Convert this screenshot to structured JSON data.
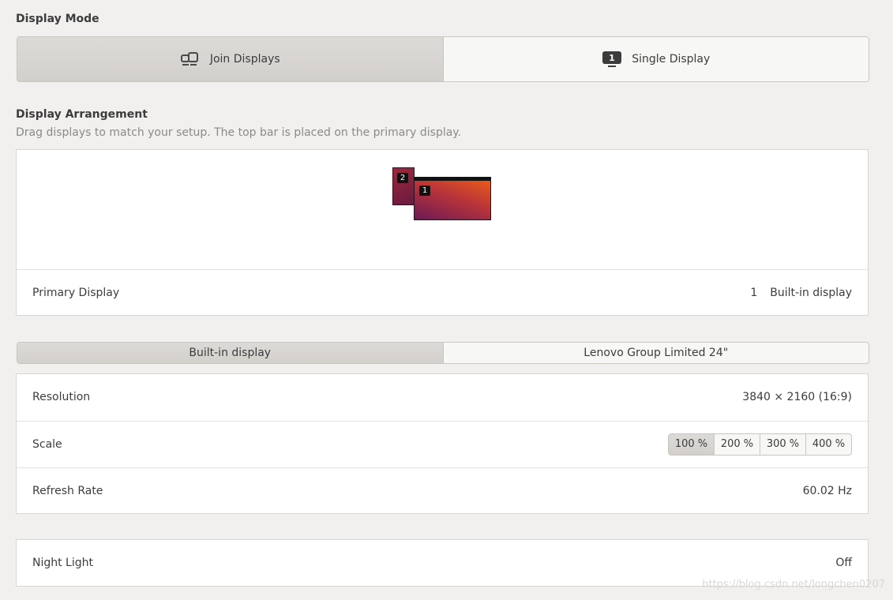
{
  "display_mode": {
    "title": "Display Mode",
    "join_label": "Join Displays",
    "single_label": "Single Display",
    "active": "join"
  },
  "arrangement": {
    "title": "Display Arrangement",
    "subtitle": "Drag displays to match your setup. The top bar is placed on the primary display.",
    "monitors": [
      {
        "id": "2",
        "label": "2"
      },
      {
        "id": "1",
        "label": "1"
      }
    ],
    "primary_label": "Primary Display",
    "primary_number": "1",
    "primary_name": "Built-in display"
  },
  "tabs": {
    "items": [
      "Built-in display",
      "Lenovo Group Limited 24\""
    ],
    "active_index": 0
  },
  "settings": {
    "resolution_label": "Resolution",
    "resolution_value": "3840 × 2160 (16:9)",
    "scale_label": "Scale",
    "scale_options": [
      "100 %",
      "200 %",
      "300 %",
      "400 %"
    ],
    "scale_active_index": 0,
    "refresh_label": "Refresh Rate",
    "refresh_value": "60.02 Hz"
  },
  "night_light": {
    "label": "Night Light",
    "value": "Off"
  },
  "watermark": "https://blog.csdn.net/longchen0207"
}
